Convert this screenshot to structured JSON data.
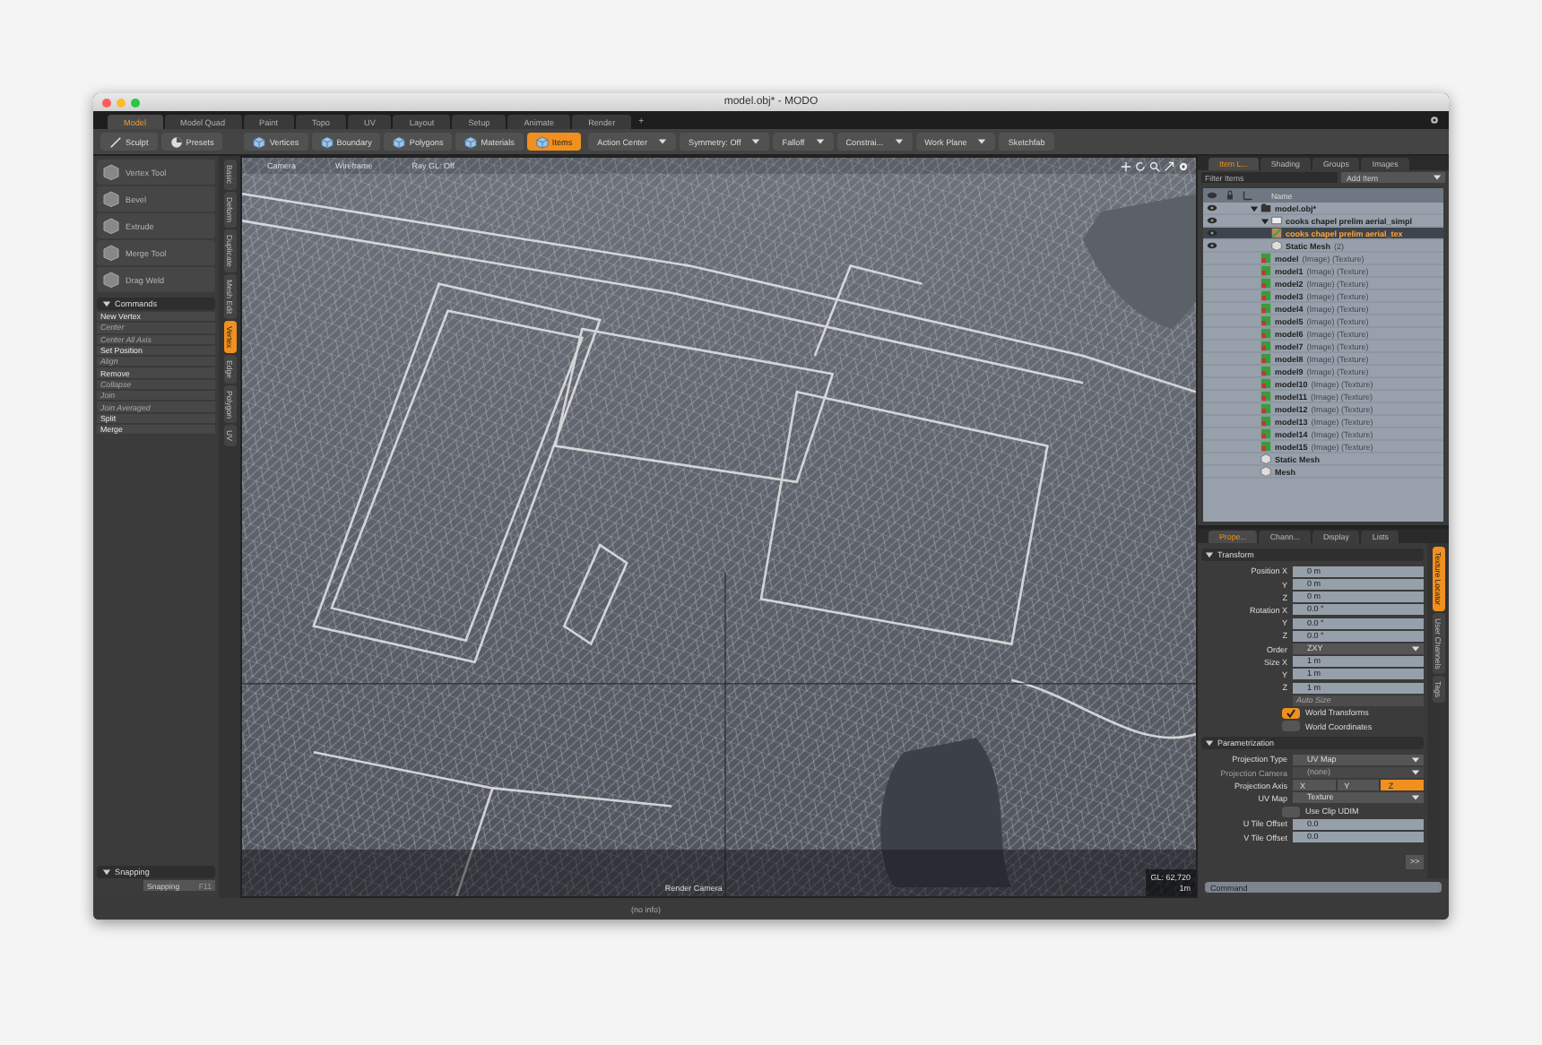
{
  "window": {
    "title": "model.obj* - MODO"
  },
  "layout_tabs": [
    {
      "label": "Model",
      "selected": true
    },
    {
      "label": "Model Quad",
      "selected": false
    },
    {
      "label": "Paint",
      "selected": false
    },
    {
      "label": "Topo",
      "selected": false
    },
    {
      "label": "UV",
      "selected": false
    },
    {
      "label": "Layout",
      "selected": false
    },
    {
      "label": "Setup",
      "selected": false
    },
    {
      "label": "Animate",
      "selected": false
    },
    {
      "label": "Render",
      "selected": false
    }
  ],
  "add_tab": "+",
  "toolbar": [
    {
      "kind": "tool",
      "label": "Sculpt",
      "selected": false
    },
    {
      "kind": "tool",
      "label": "Presets",
      "selected": false
    },
    {
      "kind": "mode",
      "label": "Vertices",
      "selected": false
    },
    {
      "kind": "mode",
      "label": "Boundary",
      "selected": false
    },
    {
      "kind": "mode",
      "label": "Polygons",
      "selected": false
    },
    {
      "kind": "mode",
      "label": "Materials",
      "selected": false
    },
    {
      "kind": "mode",
      "label": "Items",
      "selected": true
    },
    {
      "kind": "dropdown",
      "label": "Action Center",
      "selected": false
    },
    {
      "kind": "dropdown",
      "label": "Symmetry: Off",
      "selected": false
    },
    {
      "kind": "dropdown",
      "label": "Falloff",
      "selected": false
    },
    {
      "kind": "dropdown",
      "label": "Constrai...",
      "selected": false
    },
    {
      "kind": "dropdown",
      "label": "Work Plane",
      "selected": false
    },
    {
      "kind": "tool",
      "label": "Sketchfab",
      "selected": false
    }
  ],
  "tools": [
    "Vertex Tool",
    "Bevel",
    "Extrude",
    "Merge Tool",
    "Drag Weld"
  ],
  "commands": {
    "title": "Commands",
    "items": [
      {
        "label": "New Vertex",
        "disabled": false
      },
      {
        "label": "Center",
        "disabled": true
      },
      {
        "label": "Center All Axis",
        "disabled": true
      },
      {
        "label": "Set Position",
        "disabled": false
      },
      {
        "label": "Align",
        "disabled": true
      },
      {
        "label": "Remove",
        "disabled": false
      },
      {
        "label": "Collapse",
        "disabled": true
      },
      {
        "label": "Join",
        "disabled": true
      },
      {
        "label": "Join Averaged",
        "disabled": true
      },
      {
        "label": "Split",
        "disabled": false
      },
      {
        "label": "Merge",
        "disabled": false
      }
    ]
  },
  "side_tabs": [
    {
      "label": "Basic",
      "selected": false
    },
    {
      "label": "Deform",
      "selected": false
    },
    {
      "label": "Duplicate",
      "selected": false
    },
    {
      "label": "Mesh Edit",
      "selected": false
    },
    {
      "label": "Vertex",
      "selected": true
    },
    {
      "label": "Edge",
      "selected": false
    },
    {
      "label": "Polygon",
      "selected": false
    },
    {
      "label": "UV",
      "selected": false
    }
  ],
  "snapping": {
    "title": "Snapping",
    "button": "Snapping",
    "shortcut": "F11"
  },
  "viewport": {
    "header": [
      "Camera",
      "Wireframe",
      "Ray GL: Off"
    ],
    "stats": [
      "GL: 62,720",
      "1m"
    ],
    "camera_label": "Render Camera"
  },
  "status_bar": "(no info)",
  "item_list": {
    "tabs": [
      {
        "label": "Item L...",
        "selected": true
      },
      {
        "label": "Shading",
        "selected": false
      },
      {
        "label": "Groups",
        "selected": false
      },
      {
        "label": "Images",
        "selected": false
      }
    ],
    "filter_placeholder": "Filter Items",
    "add_item": "Add Item",
    "column": "Name",
    "tree": [
      {
        "name": "model.obj*",
        "kind": "scene",
        "visible": true,
        "selected": false,
        "expanded": true,
        "children": [
          {
            "name": "cooks chapel prelim aerial_simpl",
            "kind": "locator",
            "visible": true,
            "selected": false,
            "expanded": true,
            "children": [
              {
                "name": "cooks chapel prelim aerial_tex",
                "kind": "texture",
                "visible": true,
                "selected": true
              },
              {
                "name": "Static Mesh",
                "suffix": "(2)",
                "kind": "mesh",
                "visible": true,
                "selected": false
              }
            ]
          },
          {
            "name": "model",
            "suffix": "(Image) (Texture)",
            "kind": "image",
            "visible": false,
            "selected": false
          },
          {
            "name": "model1",
            "suffix": "(Image) (Texture)",
            "kind": "image",
            "visible": false,
            "selected": false
          },
          {
            "name": "model2",
            "suffix": "(Image) (Texture)",
            "kind": "image",
            "visible": false,
            "selected": false
          },
          {
            "name": "model3",
            "suffix": "(Image) (Texture)",
            "kind": "image",
            "visible": false,
            "selected": false
          },
          {
            "name": "model4",
            "suffix": "(Image) (Texture)",
            "kind": "image",
            "visible": false,
            "selected": false
          },
          {
            "name": "model5",
            "suffix": "(Image) (Texture)",
            "kind": "image",
            "visible": false,
            "selected": false
          },
          {
            "name": "model6",
            "suffix": "(Image) (Texture)",
            "kind": "image",
            "visible": false,
            "selected": false
          },
          {
            "name": "model7",
            "suffix": "(Image) (Texture)",
            "kind": "image",
            "visible": false,
            "selected": false
          },
          {
            "name": "model8",
            "suffix": "(Image) (Texture)",
            "kind": "image",
            "visible": false,
            "selected": false
          },
          {
            "name": "model9",
            "suffix": "(Image) (Texture)",
            "kind": "image",
            "visible": false,
            "selected": false
          },
          {
            "name": "model10",
            "suffix": "(Image) (Texture)",
            "kind": "image",
            "visible": false,
            "selected": false
          },
          {
            "name": "model11",
            "suffix": "(Image) (Texture)",
            "kind": "image",
            "visible": false,
            "selected": false
          },
          {
            "name": "model12",
            "suffix": "(Image) (Texture)",
            "kind": "image",
            "visible": false,
            "selected": false
          },
          {
            "name": "model13",
            "suffix": "(Image) (Texture)",
            "kind": "image",
            "visible": false,
            "selected": false
          },
          {
            "name": "model14",
            "suffix": "(Image) (Texture)",
            "kind": "image",
            "visible": false,
            "selected": false
          },
          {
            "name": "model15",
            "suffix": "(Image) (Texture)",
            "kind": "image",
            "visible": false,
            "selected": false
          },
          {
            "name": "Static Mesh",
            "kind": "mesh",
            "visible": false,
            "selected": false
          },
          {
            "name": "Mesh",
            "kind": "mesh",
            "visible": false,
            "selected": false
          }
        ]
      }
    ]
  },
  "properties": {
    "tabs": [
      {
        "label": "Prope...",
        "selected": true
      },
      {
        "label": "Chann...",
        "selected": false
      },
      {
        "label": "Display",
        "selected": false
      },
      {
        "label": "Lists",
        "selected": false
      }
    ],
    "side_tabs": [
      {
        "label": "Texture Locator",
        "selected": true
      },
      {
        "label": "User Channels",
        "selected": false
      },
      {
        "label": "Tags",
        "selected": false
      }
    ],
    "sections": [
      {
        "title": "Transform",
        "expanded": true,
        "rows": [
          {
            "kind": "field",
            "label": "Position X",
            "value": "0 m"
          },
          {
            "kind": "field",
            "label": "Y",
            "value": "0 m"
          },
          {
            "kind": "field",
            "label": "Z",
            "value": "0 m"
          },
          {
            "kind": "field",
            "label": "Rotation X",
            "value": "0.0 °"
          },
          {
            "kind": "field",
            "label": "Y",
            "value": "0.0 °"
          },
          {
            "kind": "field",
            "label": "Z",
            "value": "0.0 °"
          },
          {
            "kind": "dropdown",
            "label": "Order",
            "value": "ZXY",
            "disabled": false
          },
          {
            "kind": "field",
            "label": "Size X",
            "value": "1 m"
          },
          {
            "kind": "field",
            "label": "Y",
            "value": "1 m"
          },
          {
            "kind": "field",
            "label": "Z",
            "value": "1 m"
          },
          {
            "kind": "button",
            "label": "Auto Size",
            "disabled": true
          },
          {
            "kind": "checkbox",
            "label": "World Transforms",
            "checked": true
          },
          {
            "kind": "checkbox",
            "label": "World Coordinates",
            "checked": false
          }
        ]
      },
      {
        "title": "Parametrization",
        "expanded": true,
        "rows": [
          {
            "kind": "dropdown",
            "label": "Projection Type",
            "value": "UV Map",
            "disabled": false
          },
          {
            "kind": "dropdown",
            "label": "Projection Camera",
            "value": "(none)",
            "disabled": true
          },
          {
            "kind": "segmented",
            "label": "Projection Axis",
            "options": [
              {
                "label": "X",
                "selected": false
              },
              {
                "label": "Y",
                "selected": false
              },
              {
                "label": "Z",
                "selected": true
              }
            ]
          },
          {
            "kind": "dropdown",
            "label": "UV Map",
            "value": "Texture",
            "disabled": false
          },
          {
            "kind": "checkbox",
            "label": "Use Clip UDIM",
            "checked": false
          },
          {
            "kind": "field",
            "label": "U Tile Offset",
            "value": "0.0"
          },
          {
            "kind": "field",
            "label": "V Tile Offset",
            "value": "0.0"
          }
        ]
      }
    ],
    "more_button": ">>",
    "command_placeholder": "Command"
  }
}
